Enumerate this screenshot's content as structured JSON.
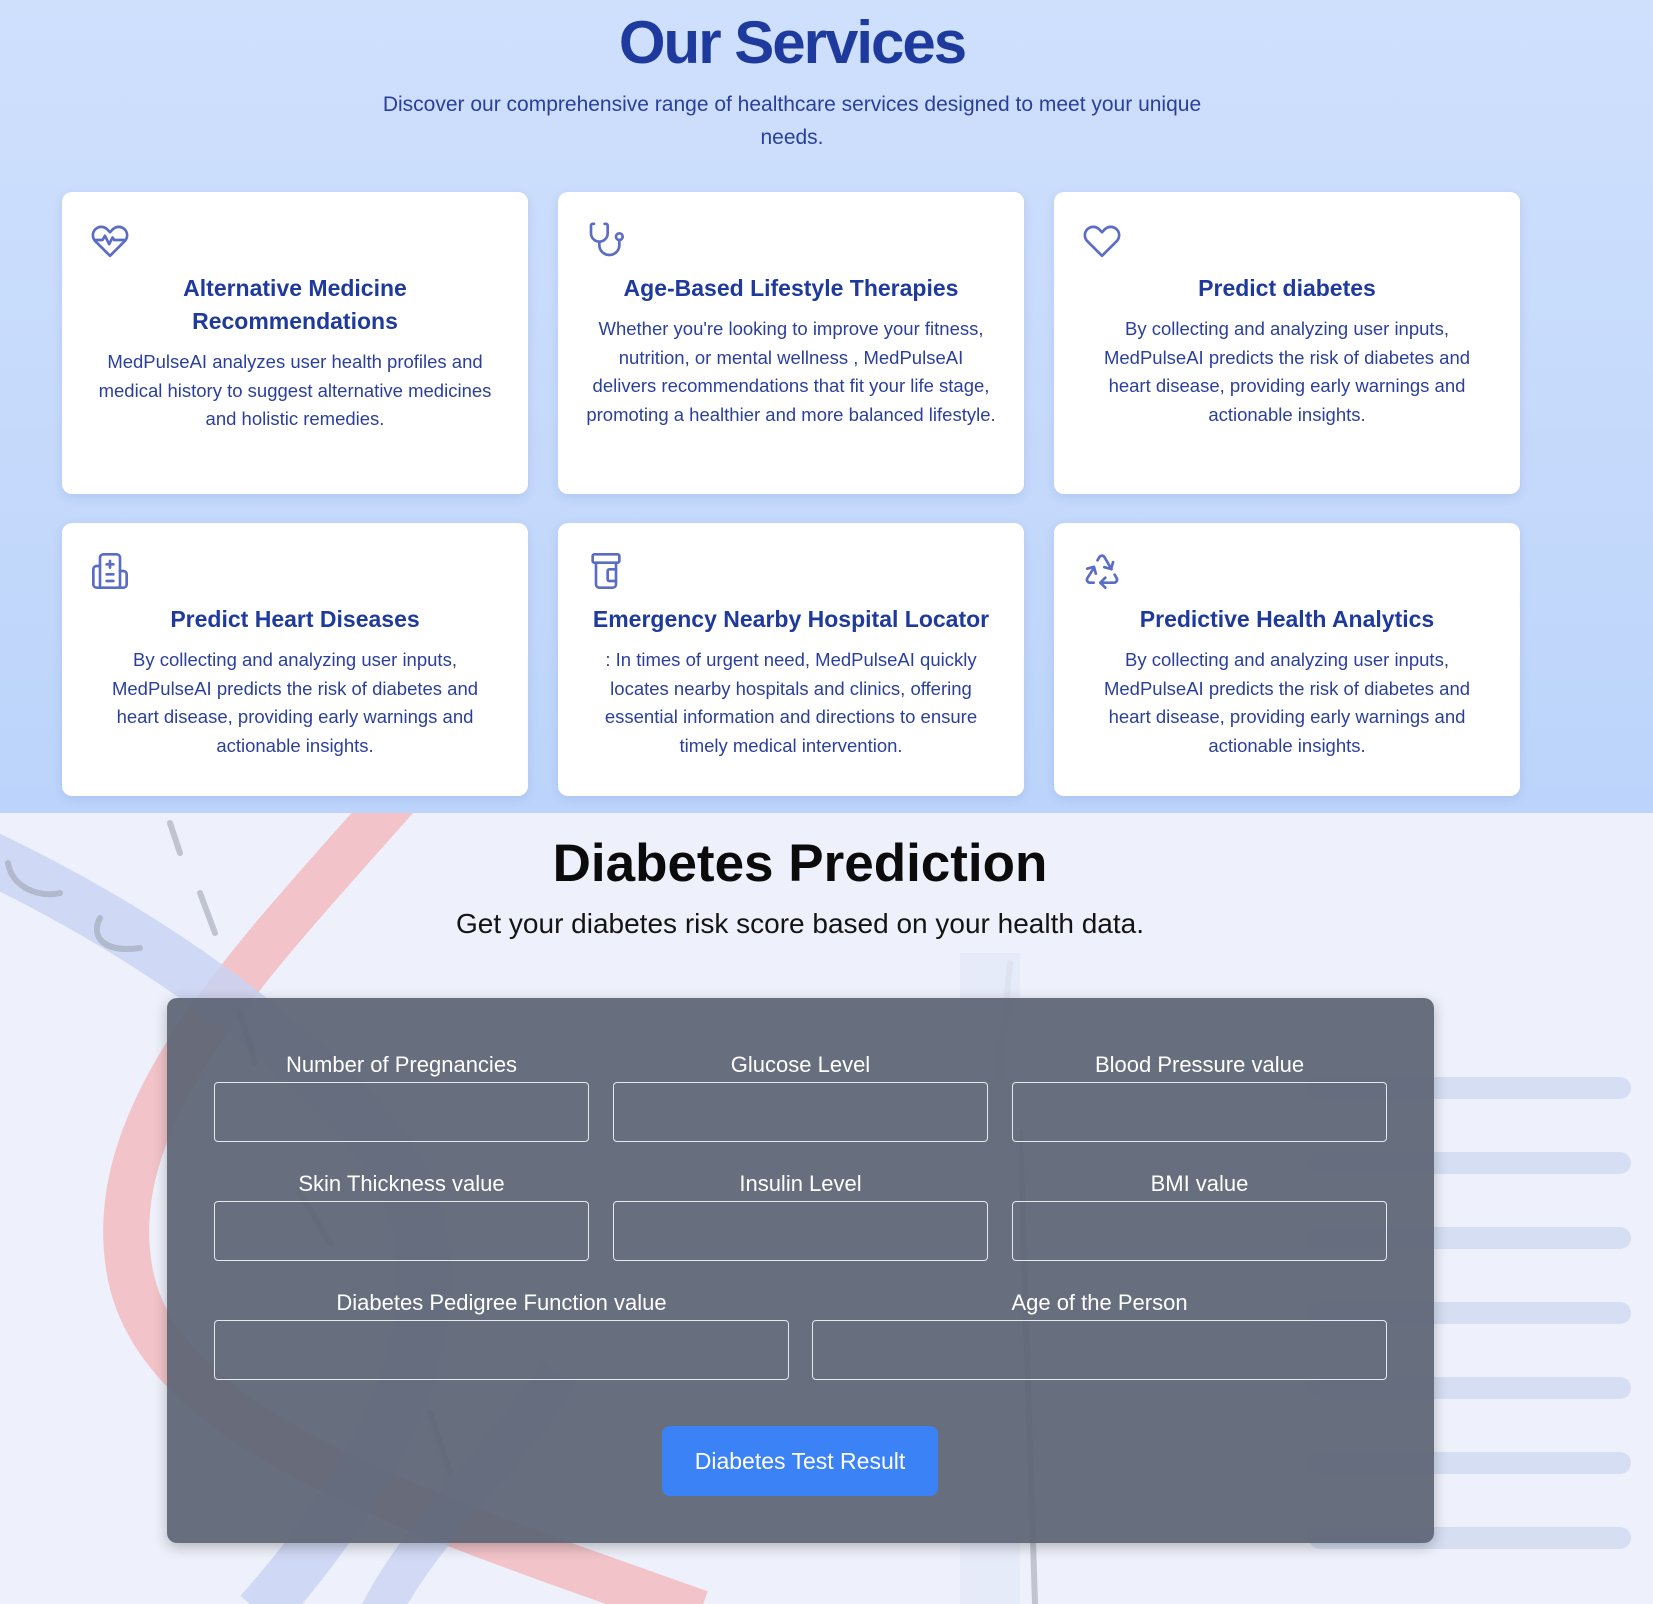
{
  "services": {
    "title": "Our Services",
    "subtitle": "Discover our comprehensive range of healthcare services designed to meet your unique needs.",
    "cards": [
      {
        "icon": "heart-pulse-icon",
        "title": "Alternative Medicine Recommendations",
        "description": "MedPulseAI analyzes user health profiles and medical history to suggest alternative medicines and holistic remedies."
      },
      {
        "icon": "stethoscope-icon",
        "title": "Age-Based Lifestyle Therapies",
        "description": "Whether you're looking to improve your fitness, nutrition, or mental wellness , MedPulseAI delivers recommendations that fit your life stage, promoting a healthier and more balanced lifestyle."
      },
      {
        "icon": "heart-icon",
        "title": "Predict diabetes",
        "description": "By collecting and analyzing user inputs, MedPulseAI predicts the risk of diabetes and heart disease, providing early warnings and actionable insights."
      },
      {
        "icon": "hospital-icon",
        "title": "Predict Heart Diseases",
        "description": "By collecting and analyzing user inputs, MedPulseAI predicts the risk of diabetes and heart disease, providing early warnings and actionable insights."
      },
      {
        "icon": "pill-bottle-icon",
        "title": "Emergency Nearby Hospital Locator",
        "description": ": In times of urgent need, MedPulseAI quickly locates nearby hospitals and clinics, offering essential information and directions to ensure timely medical intervention."
      },
      {
        "icon": "recycle-icon",
        "title": "Predictive Health Analytics",
        "description": "By collecting and analyzing user inputs, MedPulseAI predicts the risk of diabetes and heart disease, providing early warnings and actionable insights."
      }
    ],
    "colors": {
      "accent": "#1e3a9c",
      "background": "#c8dcfc"
    }
  },
  "diabetes": {
    "title": "Diabetes Prediction",
    "subtitle": "Get your diabetes risk score based on your health data.",
    "fields": [
      {
        "label": "Number of Pregnancies",
        "value": ""
      },
      {
        "label": "Glucose Level",
        "value": ""
      },
      {
        "label": "Blood Pressure value",
        "value": ""
      },
      {
        "label": "Skin Thickness value",
        "value": ""
      },
      {
        "label": "Insulin Level",
        "value": ""
      },
      {
        "label": "BMI value",
        "value": ""
      },
      {
        "label": "Diabetes Pedigree Function value",
        "value": ""
      },
      {
        "label": "Age of the Person",
        "value": ""
      }
    ],
    "submit_label": "Diabetes Test Result",
    "colors": {
      "button": "#3b82f6",
      "panel": "#5d6474"
    }
  }
}
